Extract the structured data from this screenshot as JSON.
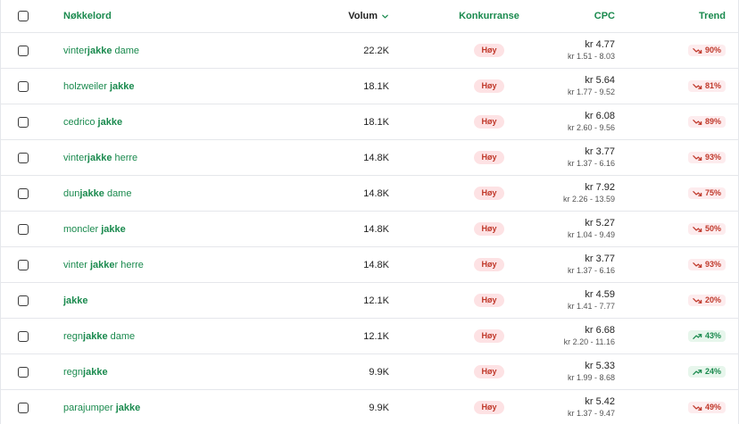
{
  "header": {
    "keyword": "Nøkkelord",
    "volume": "Volum",
    "competition": "Konkurranse",
    "cpc": "CPC",
    "trend": "Trend"
  },
  "colors": {
    "accent": "#1a8a4e",
    "high_badge_bg": "#fde2e4",
    "high_badge_text": "#c0392b",
    "trend_down_bg": "#fdecee",
    "trend_up_bg": "#e7f6ec"
  },
  "rows": [
    {
      "kw_parts": [
        {
          "t": "vinter",
          "b": false
        },
        {
          "t": "jakke",
          "b": true
        },
        {
          "t": " dame",
          "b": false
        }
      ],
      "volume": "22.2K",
      "competition": "Høy",
      "cpc": "kr 4.77",
      "cpc_range": "kr 1.51 - 8.03",
      "trend": "90%",
      "trend_dir": "down"
    },
    {
      "kw_parts": [
        {
          "t": "holzweiler ",
          "b": false
        },
        {
          "t": "jakke",
          "b": true
        }
      ],
      "volume": "18.1K",
      "competition": "Høy",
      "cpc": "kr 5.64",
      "cpc_range": "kr 1.77 - 9.52",
      "trend": "81%",
      "trend_dir": "down"
    },
    {
      "kw_parts": [
        {
          "t": "cedrico ",
          "b": false
        },
        {
          "t": "jakke",
          "b": true
        }
      ],
      "volume": "18.1K",
      "competition": "Høy",
      "cpc": "kr 6.08",
      "cpc_range": "kr 2.60 - 9.56",
      "trend": "89%",
      "trend_dir": "down"
    },
    {
      "kw_parts": [
        {
          "t": "vinter",
          "b": false
        },
        {
          "t": "jakke",
          "b": true
        },
        {
          "t": " herre",
          "b": false
        }
      ],
      "volume": "14.8K",
      "competition": "Høy",
      "cpc": "kr 3.77",
      "cpc_range": "kr 1.37 - 6.16",
      "trend": "93%",
      "trend_dir": "down"
    },
    {
      "kw_parts": [
        {
          "t": "dun",
          "b": false
        },
        {
          "t": "jakke",
          "b": true
        },
        {
          "t": " dame",
          "b": false
        }
      ],
      "volume": "14.8K",
      "competition": "Høy",
      "cpc": "kr 7.92",
      "cpc_range": "kr 2.26 - 13.59",
      "trend": "75%",
      "trend_dir": "down"
    },
    {
      "kw_parts": [
        {
          "t": "moncler ",
          "b": false
        },
        {
          "t": "jakke",
          "b": true
        }
      ],
      "volume": "14.8K",
      "competition": "Høy",
      "cpc": "kr 5.27",
      "cpc_range": "kr 1.04 - 9.49",
      "trend": "50%",
      "trend_dir": "down"
    },
    {
      "kw_parts": [
        {
          "t": "vinter ",
          "b": false
        },
        {
          "t": "jakke",
          "b": true
        },
        {
          "t": "r herre",
          "b": false
        }
      ],
      "volume": "14.8K",
      "competition": "Høy",
      "cpc": "kr 3.77",
      "cpc_range": "kr 1.37 - 6.16",
      "trend": "93%",
      "trend_dir": "down"
    },
    {
      "kw_parts": [
        {
          "t": "jakke",
          "b": true
        }
      ],
      "volume": "12.1K",
      "competition": "Høy",
      "cpc": "kr 4.59",
      "cpc_range": "kr 1.41 - 7.77",
      "trend": "20%",
      "trend_dir": "down"
    },
    {
      "kw_parts": [
        {
          "t": "regn",
          "b": false
        },
        {
          "t": "jakke",
          "b": true
        },
        {
          "t": " dame",
          "b": false
        }
      ],
      "volume": "12.1K",
      "competition": "Høy",
      "cpc": "kr 6.68",
      "cpc_range": "kr 2.20 - 11.16",
      "trend": "43%",
      "trend_dir": "up"
    },
    {
      "kw_parts": [
        {
          "t": "regn",
          "b": false
        },
        {
          "t": "jakke",
          "b": true
        }
      ],
      "volume": "9.9K",
      "competition": "Høy",
      "cpc": "kr 5.33",
      "cpc_range": "kr 1.99 - 8.68",
      "trend": "24%",
      "trend_dir": "up"
    },
    {
      "kw_parts": [
        {
          "t": "parajumper ",
          "b": false
        },
        {
          "t": "jakke",
          "b": true
        }
      ],
      "volume": "9.9K",
      "competition": "Høy",
      "cpc": "kr 5.42",
      "cpc_range": "kr 1.37 - 9.47",
      "trend": "49%",
      "trend_dir": "down"
    }
  ]
}
